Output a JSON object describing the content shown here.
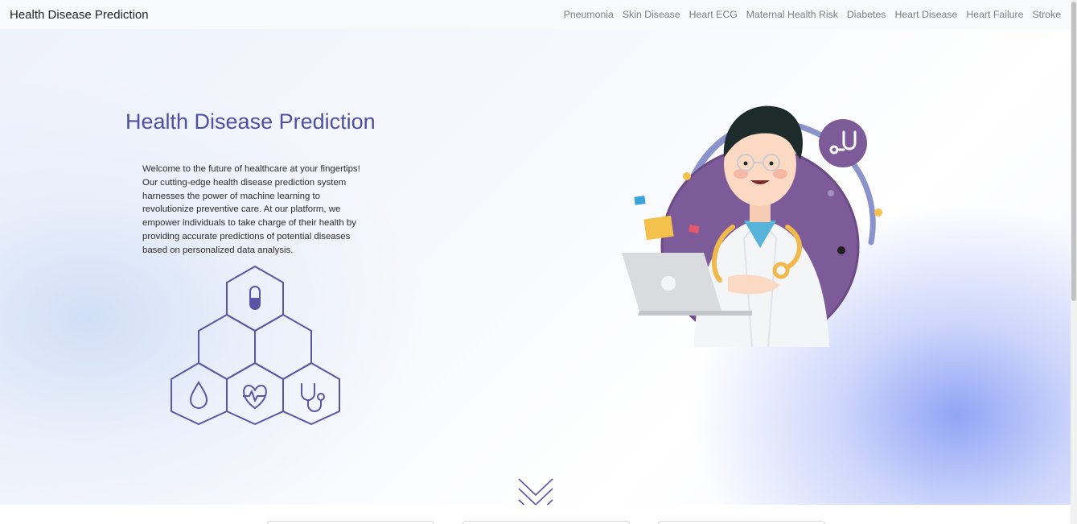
{
  "navbar": {
    "brand": "Health Disease Prediction",
    "links": [
      "Pneumonia",
      "Skin Disease",
      "Heart ECG",
      "Maternal Health Risk",
      "Diabetes",
      "Heart Disease",
      "Heart Failure",
      "Stroke"
    ]
  },
  "hero": {
    "title": "Health Disease Prediction",
    "description": "Welcome to the future of healthcare at your fingertips! Our cutting-edge health disease prediction system harnesses the power of machine learning to revolutionize preventive care. At our platform, we empower individuals to take charge of their health by providing accurate predictions of potential diseases based on personalized data analysis."
  },
  "icons": {
    "hex_grid": [
      "pill-icon",
      "drop-icon",
      "heartbeat-icon",
      "stethoscope-icon"
    ],
    "illustration": "doctor-illustration",
    "scroll": "chevron-down-icon"
  },
  "colors": {
    "accent": "#5050a3",
    "hex_stroke": "#5a55a8",
    "purple_circle": "#7d5a98",
    "blob": "#8ea0f3"
  }
}
